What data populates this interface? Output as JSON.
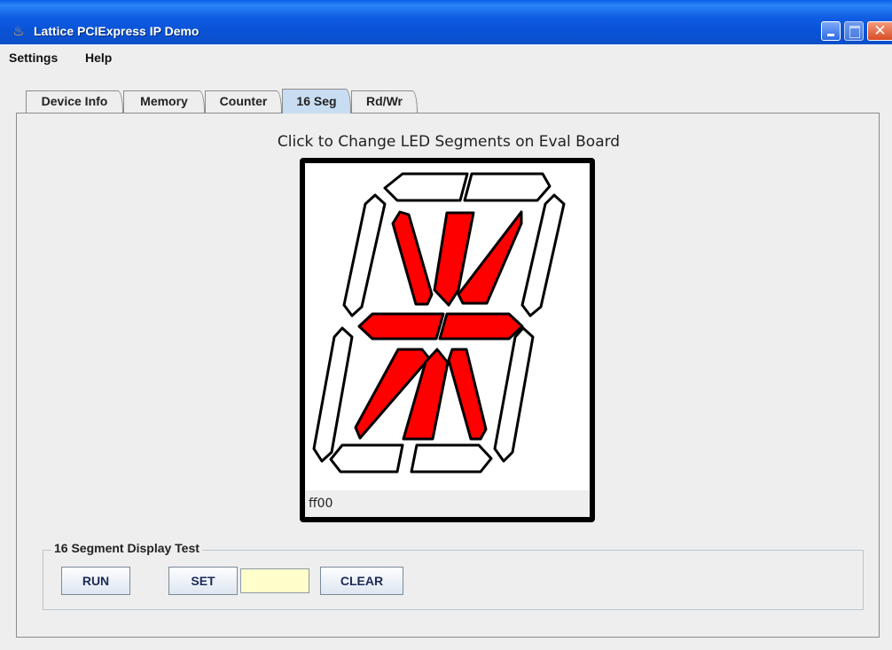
{
  "window": {
    "title": "Lattice PCIExpress IP Demo",
    "title_icon": "java-cup-icon",
    "close_glyph": "✕"
  },
  "menu": {
    "items": [
      "Settings",
      "Help"
    ]
  },
  "tabs": [
    {
      "label": "Device Info",
      "active": false
    },
    {
      "label": "Memory",
      "active": false
    },
    {
      "label": "Counter",
      "active": false
    },
    {
      "label": "16 Seg",
      "active": true
    },
    {
      "label": "Rd/Wr",
      "active": false
    }
  ],
  "panel": {
    "heading": "Click to Change LED Segments on Eval Board"
  },
  "display": {
    "value": "ff00",
    "on_color": "#FF0000",
    "off_color": "#FFFFFF",
    "segments": {
      "top_left": false,
      "top_right": false,
      "upper_left": false,
      "upper_right": false,
      "diag_upper_left": true,
      "center_upper": true,
      "diag_upper_right": true,
      "middle_left": true,
      "middle_right": true,
      "diag_lower_left": true,
      "center_lower": true,
      "diag_lower_right": true,
      "lower_left": false,
      "lower_right": false,
      "bottom_left": false,
      "bottom_right": false
    }
  },
  "test_group": {
    "title": "16 Segment Display Test",
    "run_label": "RUN",
    "set_label": "SET",
    "input_value": "",
    "clear_label": "CLEAR"
  }
}
